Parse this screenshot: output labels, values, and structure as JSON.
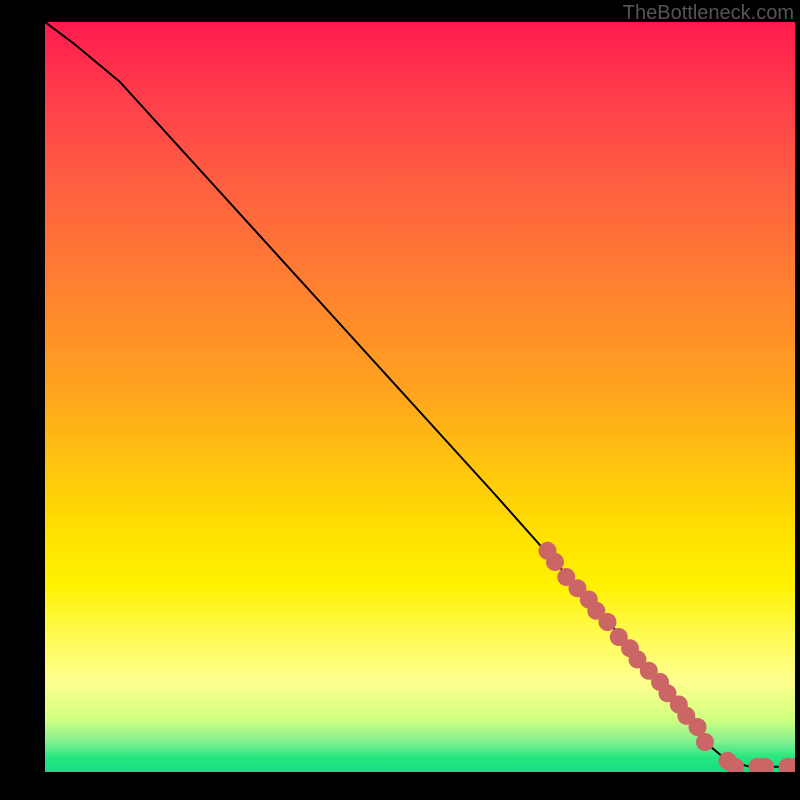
{
  "watermark": "TheBottleneck.com",
  "chart_data": {
    "type": "line",
    "title": "",
    "xlabel": "",
    "ylabel": "",
    "xlim": [
      0,
      100
    ],
    "ylim": [
      0,
      100
    ],
    "series": [
      {
        "name": "curve",
        "style": "line",
        "color": "#000000",
        "x": [
          0,
          4,
          10,
          20,
          30,
          40,
          50,
          60,
          68,
          76,
          82,
          86,
          88,
          91,
          94,
          97,
          100
        ],
        "y": [
          100,
          97,
          92,
          81,
          70,
          59,
          48,
          37,
          28,
          19,
          12,
          7,
          4,
          1.5,
          0.7,
          0.7,
          0.7
        ]
      },
      {
        "name": "markers",
        "style": "scatter",
        "color": "#cc6666",
        "points": [
          {
            "x": 67,
            "y": 29.5
          },
          {
            "x": 68,
            "y": 28
          },
          {
            "x": 69.5,
            "y": 26
          },
          {
            "x": 71,
            "y": 24.5
          },
          {
            "x": 72.5,
            "y": 23
          },
          {
            "x": 73.5,
            "y": 21.5
          },
          {
            "x": 75,
            "y": 20
          },
          {
            "x": 76.5,
            "y": 18
          },
          {
            "x": 78,
            "y": 16.5
          },
          {
            "x": 79,
            "y": 15
          },
          {
            "x": 80.5,
            "y": 13.5
          },
          {
            "x": 82,
            "y": 12
          },
          {
            "x": 83,
            "y": 10.5
          },
          {
            "x": 84.5,
            "y": 9
          },
          {
            "x": 85.5,
            "y": 7.5
          },
          {
            "x": 87,
            "y": 6
          },
          {
            "x": 88,
            "y": 4
          },
          {
            "x": 91,
            "y": 1.5
          },
          {
            "x": 92,
            "y": 0.7
          },
          {
            "x": 95,
            "y": 0.7
          },
          {
            "x": 96,
            "y": 0.7
          },
          {
            "x": 99,
            "y": 0.7
          },
          {
            "x": 100,
            "y": 0.7
          }
        ]
      }
    ]
  }
}
